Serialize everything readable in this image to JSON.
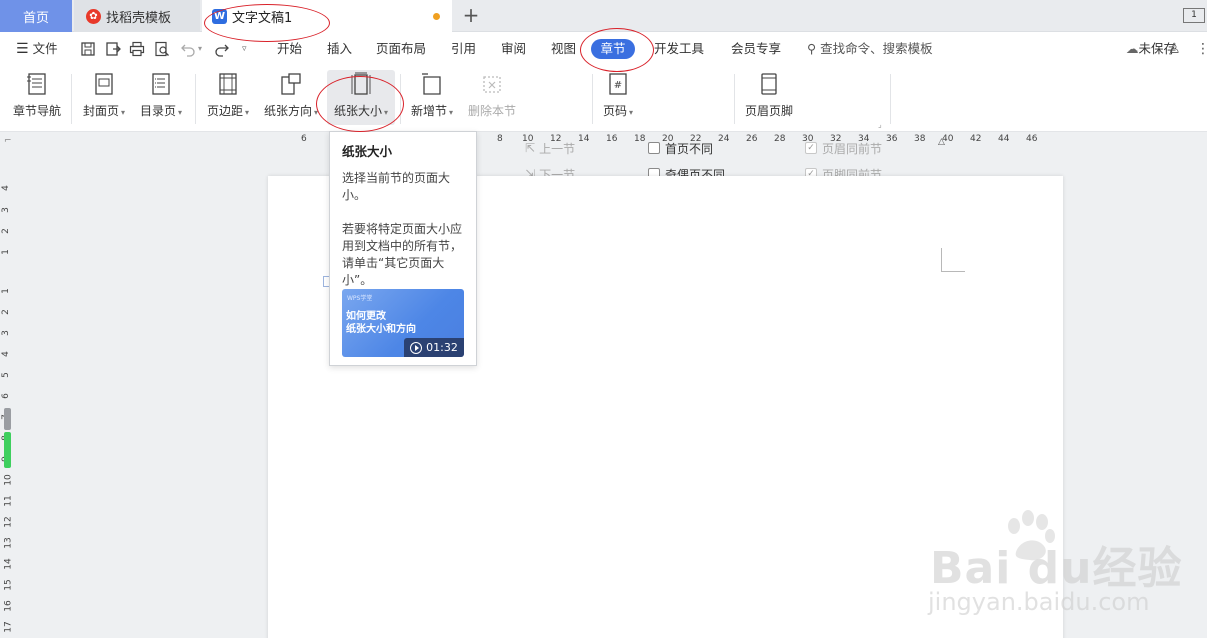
{
  "tabs": {
    "home": "首页",
    "template": "找稻壳模板",
    "document": "文字文稿1",
    "add": "+",
    "window_badge": "1"
  },
  "menu": {
    "file": "文件",
    "items": [
      "开始",
      "插入",
      "页面布局",
      "引用",
      "审阅",
      "视图",
      "章节",
      "开发工具",
      "会员专享"
    ],
    "active": "章节",
    "search": "查找命令、搜索模板",
    "unsaved": "未保存"
  },
  "ribbon": {
    "chapter_nav": "章节导航",
    "cover_page": "封面页",
    "toc_page": "目录页",
    "margins": "页边距",
    "orientation": "纸张方向",
    "paper_size": "纸张大小",
    "new_section": "新增节",
    "delete_section": "删除本节",
    "prev_section": "上一节",
    "next_section": "下一节",
    "page_number": "页码",
    "first_page_diff": "首页不同",
    "odd_even_diff": "奇偶页不同",
    "header_footer": "页眉页脚",
    "header_same_prev": "页眉同前节",
    "footer_same_prev": "页脚同前节"
  },
  "ruler": {
    "h_ticks": [
      "6",
      "8",
      "10",
      "12",
      "14",
      "16",
      "18",
      "20",
      "22",
      "24",
      "26",
      "28",
      "30",
      "32",
      "34",
      "36",
      "38",
      "40",
      "42",
      "44",
      "46"
    ],
    "v_ticks": [
      "4",
      "3",
      "2",
      "1",
      "1",
      "2",
      "3",
      "4",
      "5",
      "6",
      "7",
      "8",
      "9",
      "10",
      "11",
      "12",
      "13",
      "14",
      "15",
      "16",
      "17"
    ]
  },
  "tooltip": {
    "title": "纸张大小",
    "desc1": "选择当前节的页面大小。",
    "desc2": "若要将特定页面大小应用到文档中的所有节，请单击“其它页面大小”。",
    "video_tag": "WPS学堂",
    "video_title": "如何更改\n纸张大小和方向",
    "duration": "01:32"
  },
  "watermark": {
    "logo": "Bai du经验",
    "url": "jingyan.baidu.com"
  },
  "colors": {
    "accent": "#3a6fe0",
    "home_tab": "#6f92e8",
    "annotation": "#d9222a",
    "unsaved_dot": "#f0a020"
  }
}
